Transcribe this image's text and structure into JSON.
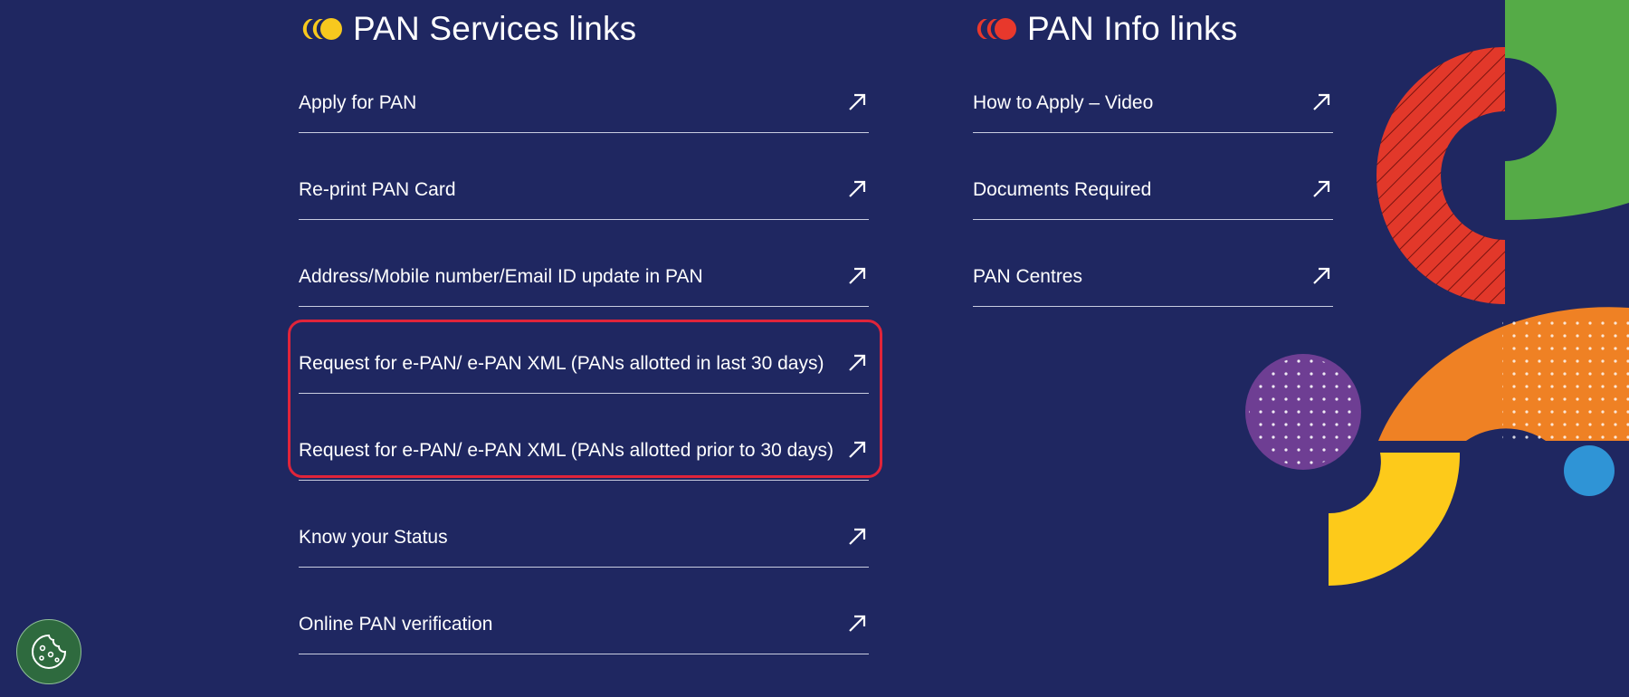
{
  "services": {
    "heading": "PAN Services links",
    "heading_icon": "yellow-dots-logo-icon",
    "heading_icon_color": "#f7c81e",
    "links": [
      {
        "label": "Apply for PAN",
        "icon": "external-arrow-icon"
      },
      {
        "label": "Re-print PAN Card",
        "icon": "external-arrow-icon"
      },
      {
        "label": "Address/Mobile number/Email ID update in PAN",
        "icon": "external-arrow-icon"
      },
      {
        "label": "Request for e-PAN/ e-PAN XML (PANs allotted in last 30 days)",
        "icon": "external-arrow-icon"
      },
      {
        "label": "Request for e-PAN/ e-PAN XML (PANs allotted prior to 30 days)",
        "icon": "external-arrow-icon"
      },
      {
        "label": "Know your Status",
        "icon": "external-arrow-icon"
      },
      {
        "label": "Online PAN verification",
        "icon": "external-arrow-icon"
      }
    ]
  },
  "info": {
    "heading": "PAN Info links",
    "heading_icon": "red-dots-logo-icon",
    "heading_icon_color": "#e8382c",
    "links": [
      {
        "label": "How to Apply – Video",
        "icon": "external-arrow-icon"
      },
      {
        "label": "Documents Required",
        "icon": "external-arrow-icon"
      },
      {
        "label": "PAN Centres",
        "icon": "external-arrow-icon"
      }
    ]
  },
  "highlight_color": "#e0243a",
  "cookie_button": {
    "icon": "cookie-icon",
    "color": "#2e6a3e"
  },
  "colors": {
    "background": "#1f2761",
    "text": "#ffffff",
    "divider": "#c9cde0",
    "decor_green": "#55ab47",
    "decor_red": "#e2382a",
    "decor_orange": "#ef8124",
    "decor_yellow": "#fdca1a",
    "decor_purple": "#6e3e93",
    "decor_blue": "#2f94d6"
  }
}
